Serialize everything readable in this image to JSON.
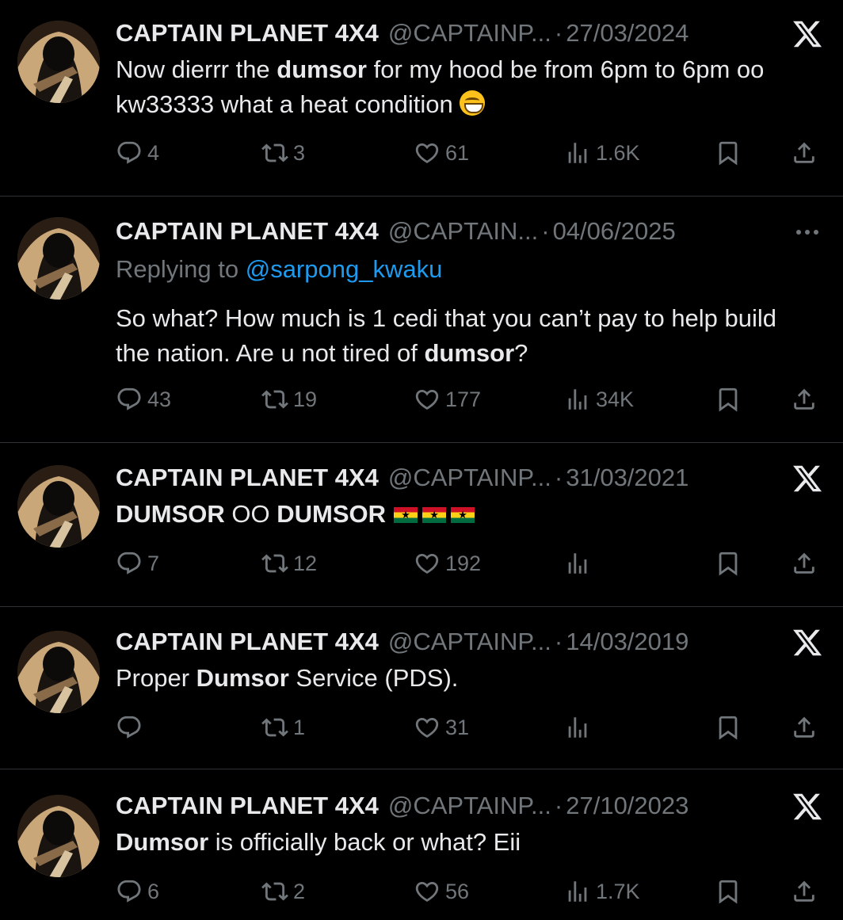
{
  "tweets": [
    {
      "name": "CAPTAIN PLANET 4X4",
      "handle": "@CAPTAINP...",
      "date": "27/03/2024",
      "corner_icon": "x-logo-icon",
      "text_parts": [
        "Now dierrr the ",
        "dumsor",
        " for my hood be from 6pm to 6pm oo kw33333 what a heat condition"
      ],
      "emoji": "grinning-face",
      "reply_count": "4",
      "retweet_count": "3",
      "like_count": "61",
      "view_count": "1.6K"
    },
    {
      "name": "CAPTAIN PLANET 4X4",
      "handle": "@CAPTAIN...",
      "date": "04/06/2025",
      "corner_icon": "more-options-icon",
      "replying_prefix": "Replying to ",
      "replying_handle": "@sarpong_kwaku",
      "text_parts": [
        "So what? How much is 1 cedi that you can’t pay to help build the nation. Are u not tired of ",
        "dumsor",
        "?"
      ],
      "reply_count": "43",
      "retweet_count": "19",
      "like_count": "177",
      "view_count": "34K"
    },
    {
      "name": "CAPTAIN PLANET 4X4",
      "handle": "@CAPTAINP...",
      "date": "31/03/2021",
      "corner_icon": "x-logo-icon",
      "text_parts": [
        "DUMSOR",
        " OO ",
        "DUMSOR"
      ],
      "flags": "ghana-flag x3",
      "reply_count": "7",
      "retweet_count": "12",
      "like_count": "192",
      "view_count": ""
    },
    {
      "name": "CAPTAIN PLANET 4X4",
      "handle": "@CAPTAINP...",
      "date": "14/03/2019",
      "corner_icon": "x-logo-icon",
      "text_parts": [
        "Proper ",
        "Dumsor",
        " Service (PDS)."
      ],
      "reply_count": "",
      "retweet_count": "1",
      "like_count": "31",
      "view_count": ""
    },
    {
      "name": "CAPTAIN PLANET 4X4",
      "handle": "@CAPTAINP...",
      "date": "27/10/2023",
      "corner_icon": "x-logo-icon",
      "text_parts": [
        "Dumsor",
        " is officially back or what? Eii"
      ],
      "reply_count": "6",
      "retweet_count": "2",
      "like_count": "56",
      "view_count": "1.7K"
    }
  ],
  "separator": "·",
  "colors": {
    "background": "#000000",
    "text": "#e7e9ea",
    "muted": "#71767b",
    "link": "#1d9bf0",
    "divider": "#2f3336"
  }
}
